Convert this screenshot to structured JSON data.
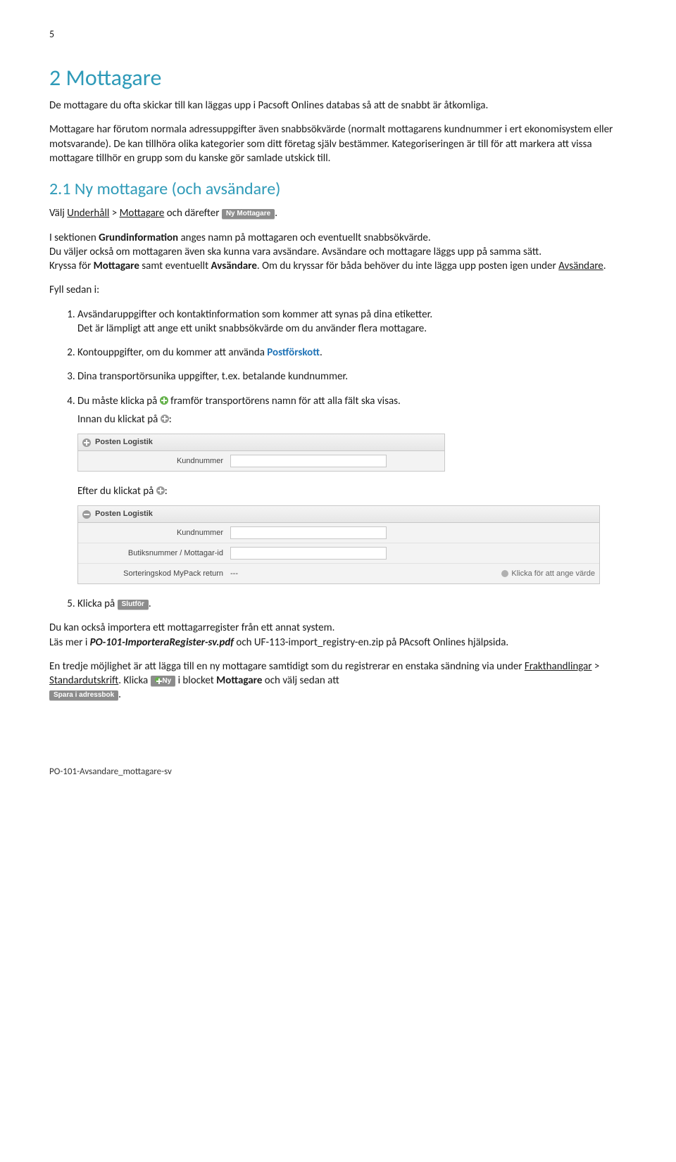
{
  "page_number": "5",
  "h1": "2  Mottagare",
  "intro_p1": "De mottagare du ofta skickar till kan läggas upp i Pacsoft Onlines databas så att de snabbt är åtkomliga.",
  "intro_p2": "Mottagare har förutom normala adressuppgifter även snabbsökvärde (normalt mottagarens kundnummer i ert ekonomisystem eller motsvarande). De kan tillhöra olika kategorier som ditt företag själv bestämmer. Kategoriseringen är till för att markera att vissa mottagare tillhör en grupp som du kanske gör samlade utskick till.",
  "h2": "2.1  Ny mottagare (och avsändare)",
  "line_valj_pre": "Välj ",
  "line_valj_u1": "Underhåll",
  "line_valj_mid": " > ",
  "line_valj_u2": "Mottagare",
  "line_valj_post": " och därefter ",
  "btn_ny_mottagare": "Ny Mottagare",
  "p_sektion1": "I sektionen ",
  "p_sektion_b": "Grundinformation",
  "p_sektion2": " anges namn på mottagaren och eventuellt snabbsökvärde.",
  "p_duvaljer": "Du väljer också om mottagaren även ska kunna vara avsändare. Avsändare och mottagare läggs upp på samma sätt.",
  "p_kryssa1": "Kryssa för ",
  "p_kryssa_b1": "Mottagare",
  "p_kryssa_mid": " samt eventuellt ",
  "p_kryssa_b2": "Avsändare",
  "p_kryssa2": ". Om du kryssar för båda behöver du inte lägga upp posten igen under ",
  "p_kryssa_u": "Avsändare",
  "fyll": "Fyll sedan i:",
  "li1a": "Avsändaruppgifter och kontaktinformation som kommer att synas på dina etiketter.",
  "li1b": "Det är lämpligt att ange ett unikt snabbsökvärde om du använder flera mottagare.",
  "li2a": "Kontouppgifter, om du kommer att använda ",
  "li2_link": "Postförskott",
  "li3": "Dina transportörsunika uppgifter, t.ex. betalande kundnummer.",
  "li4a": "Du måste klicka på ",
  "li4b": " framför transportörens namn för att alla fält ska visas.",
  "innan": "Innan du klickat på ",
  "efter": "Efter du klickat på ",
  "panel1": {
    "title": "Posten Logistik",
    "rows": [
      {
        "label": "Kundnummer"
      }
    ]
  },
  "panel2": {
    "title": "Posten Logistik",
    "rows": [
      {
        "label": "Kundnummer"
      },
      {
        "label": "Butiksnummer / Mottagar-id"
      },
      {
        "label": "Sorteringskod MyPack return",
        "value": "---",
        "hint": "Klicka för att ange värde"
      }
    ]
  },
  "li5a": "Klicka på ",
  "btn_slutfor": "Slutför",
  "outro1": "Du kan också importera ett mottagarregister från ett annat system.",
  "outro2a": "Läs mer i ",
  "outro2_i": "PO-101-ImporteraRegister-sv.pdf",
  "outro2b": " och UF-113-import_registry-en.zip på PAcsoft Onlines hjälpsida.",
  "outro3a": "En tredje möjlighet är att lägga till en ny mottagare samtidigt som du registrerar en enstaka sändning via under ",
  "outro3_u1": "Frakthandlingar",
  "outro3_mid": " > ",
  "outro3_u2": "Standardutskrift",
  "outro3b": ". Klicka ",
  "btn_ny": "Ny",
  "outro3c": " i blocket ",
  "outro3_b": "Mottagare",
  "outro3d": " och välj sedan att ",
  "btn_spara": "Spara i adressbok",
  "footer": "PO-101-Avsandare_mottagare-sv"
}
